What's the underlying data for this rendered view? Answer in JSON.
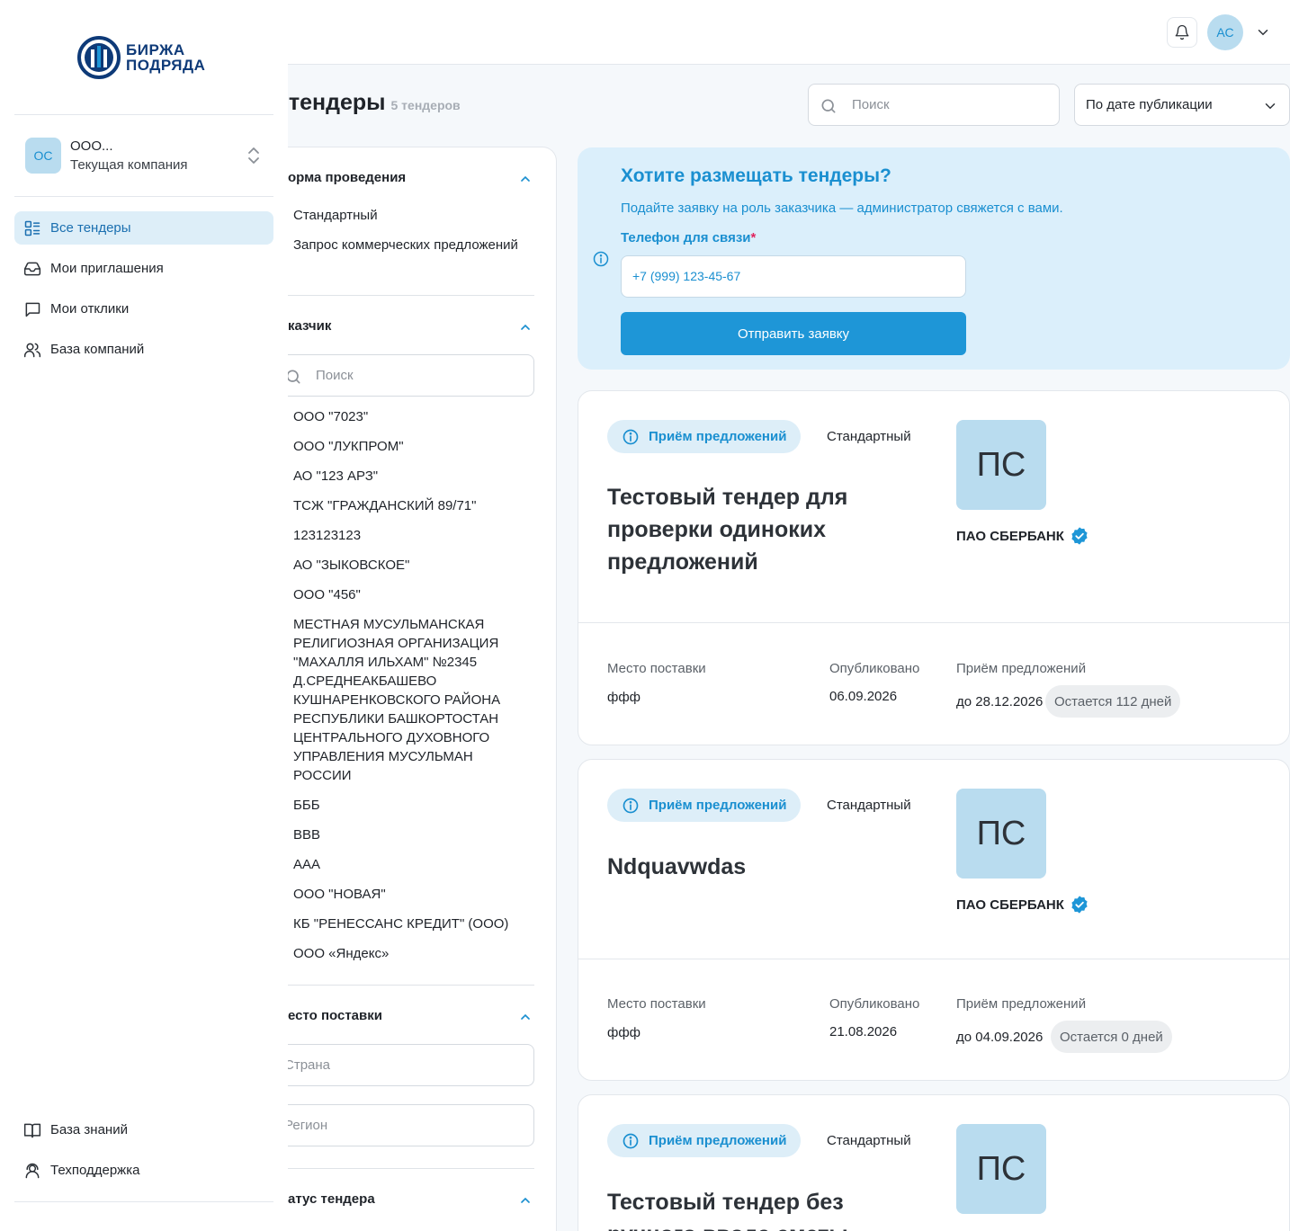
{
  "brand": {
    "line1": "БИРЖА",
    "line2": "ПОДРЯДА",
    "color": "#0e3a78"
  },
  "company": {
    "avatar": "ОС",
    "name": "ООО...",
    "subtitle": "Текущая компания"
  },
  "nav": {
    "items": [
      {
        "label": "Все тендеры",
        "icon": "list-icon",
        "active": true
      },
      {
        "label": "Мои приглашения",
        "icon": "inbox-icon"
      },
      {
        "label": "Мои отклики",
        "icon": "chat-icon"
      },
      {
        "label": "База компаний",
        "icon": "users-icon"
      }
    ],
    "bottom": [
      {
        "label": "База знаний",
        "icon": "book-icon"
      },
      {
        "label": "Техподдержка",
        "icon": "support-icon"
      }
    ]
  },
  "header": {
    "user_avatar": "АС"
  },
  "page": {
    "title": "е тендеры",
    "count": "5 тендеров",
    "search_placeholder": "Поиск",
    "sort_value": "По дате публикации"
  },
  "filters": {
    "form": {
      "title": "орма проведения",
      "options": [
        "Стандартный",
        "Запрос коммерческих предложений"
      ]
    },
    "customer": {
      "title": "казчик",
      "search_placeholder": "Поиск",
      "options": [
        "ООО \"7023\"",
        "ООО \"ЛУКПРОМ\"",
        "АО \"123 АРЗ\"",
        "ТСЖ \"ГРАЖДАНСКИЙ 89/71\"",
        "123123123",
        "АО \"ЗЫКОВСКОЕ\"",
        "ООО \"456\"",
        "МЕСТНАЯ МУСУЛЬМАНСКАЯ РЕЛИГИОЗНАЯ ОРГАНИЗАЦИЯ \"МАХАЛЛЯ ИЛЬХАМ\" №2345 Д.СРЕДНЕАКБАШЕВО КУШНАРЕНКОВСКОГО РАЙОНА РЕСПУБЛИКИ БАШКОРТОСТАН ЦЕНТРАЛЬНОГО ДУХОВНОГО УПРАВЛЕНИЯ МУСУЛЬМАН РОССИИ",
        "БББ",
        "ВВВ",
        "ААА",
        "ООО \"НОВАЯ\"",
        "КБ \"РЕНЕССАНС КРЕДИТ\" (ООО)",
        "ООО «Яндекс»"
      ]
    },
    "place": {
      "title": "есто поставки",
      "country_placeholder": "Страна",
      "region_placeholder": "Регион"
    },
    "status": {
      "title": "атус тендера"
    }
  },
  "promo": {
    "title": "Хотите размещать тендеры?",
    "text": "Подайте заявку на роль заказчика — администратор свяжется с вами.",
    "phone_label": "Телефон для связи",
    "required_mark": "*",
    "phone_placeholder": "+7 (999) 123-45-67",
    "submit_label": "Отправить заявку"
  },
  "labels": {
    "place": "Место поставки",
    "published": "Опубликовано",
    "accepting": "Приём предложений"
  },
  "tenders": [
    {
      "status": "Приём предложений",
      "type": "Стандартный",
      "title": "Тестовый тендер для проверки одиноких предложений",
      "org_logo": "ПС",
      "org_name": "ПАО СБЕРБАНК",
      "place": "ффф",
      "published": "06.09.2026",
      "deadline": "до 28.12.2026",
      "remaining": "Остается 112 дней"
    },
    {
      "status": "Приём предложений",
      "type": "Стандартный",
      "title": "Ndquavwdas",
      "org_logo": "ПС",
      "org_name": "ПАО СБЕРБАНК",
      "place": "ффф",
      "published": "21.08.2026",
      "deadline": "до 04.09.2026",
      "remaining": "Остается 0 дней"
    },
    {
      "status": "Приём предложений",
      "type": "Стандартный",
      "title": "Тестовый тендер без ручного ввода сметы",
      "org_logo": "ПС"
    }
  ],
  "colors": {
    "accent": "#1a8fd0",
    "button": "#1e96d7",
    "promo_bg": "#dbeffb",
    "verified": "#1e96d7"
  }
}
